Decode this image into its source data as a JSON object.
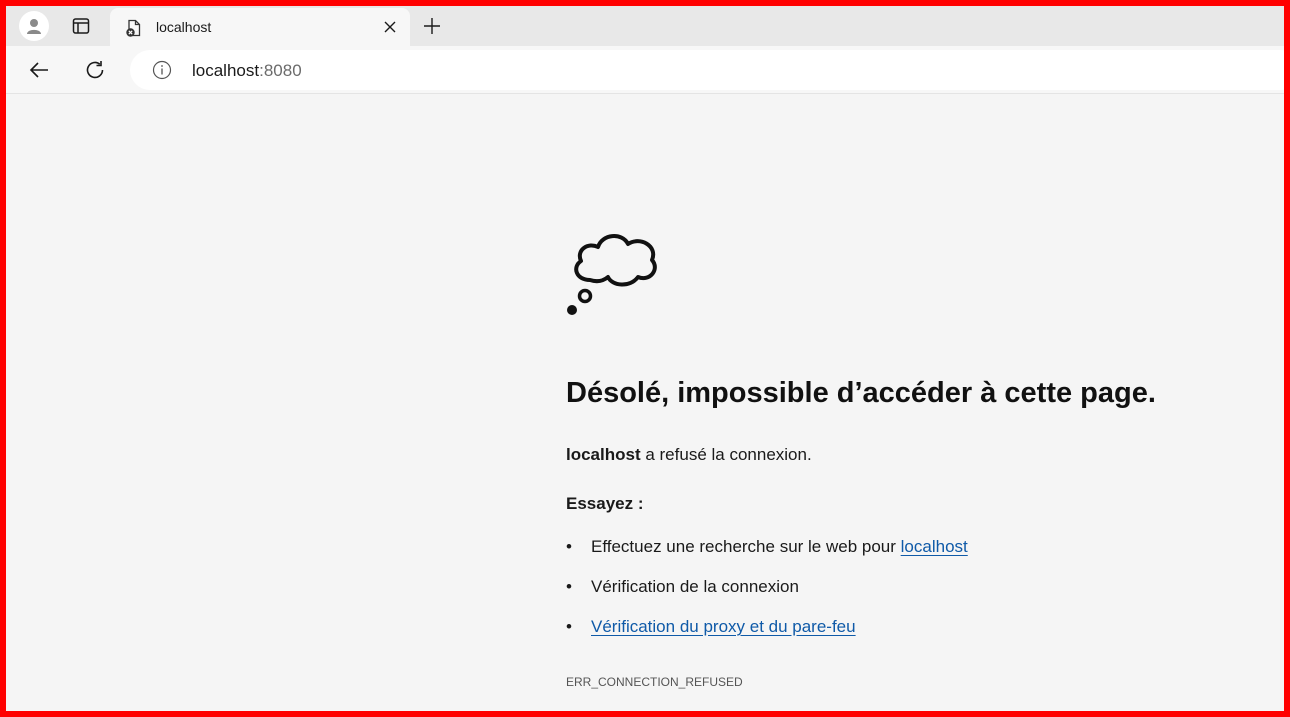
{
  "tab": {
    "title": "localhost",
    "favicon": "error-page-icon"
  },
  "toolbar": {
    "url_host": "localhost",
    "url_port": ":8080"
  },
  "error": {
    "icon": "thought-cloud-icon",
    "heading": "Désolé, impossible d’accéder à cette page.",
    "host": "localhost",
    "message": " a refusé la connexion.",
    "try_label": "Essayez :",
    "suggestions": [
      {
        "prefix": "Effectuez une recherche sur le web pour ",
        "link": "localhost"
      },
      {
        "prefix": "Vérification de la connexion",
        "link": ""
      },
      {
        "prefix": "",
        "link": "Vérification du proxy et du pare-feu"
      }
    ],
    "bullet": "•",
    "code": "ERR_CONNECTION_REFUSED"
  },
  "colors": {
    "border": "#ff0000",
    "page_bg": "#f5f5f5",
    "link": "#0f5aa8"
  }
}
